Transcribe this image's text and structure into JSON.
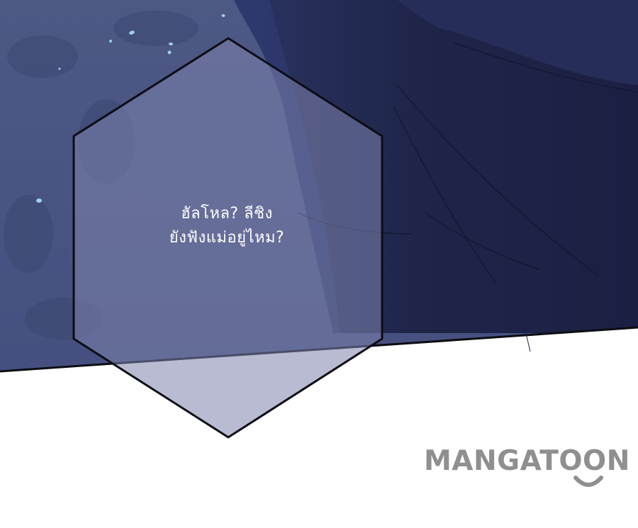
{
  "speech_bubble": {
    "line1": "ฮัลโหล? ลีชิง",
    "line2": "ยังฟังแม่อยู่ไหม?"
  },
  "watermark": {
    "text": "MANGATOON"
  },
  "colors": {
    "left_panel_bg": "#4c5783",
    "right_panel_bg": "#1f2548",
    "bubble_fill": "#7d83ad",
    "bubble_outline": "#0d0d14",
    "page_bg": "#ffffff",
    "watermark": "#8f8f8f"
  }
}
